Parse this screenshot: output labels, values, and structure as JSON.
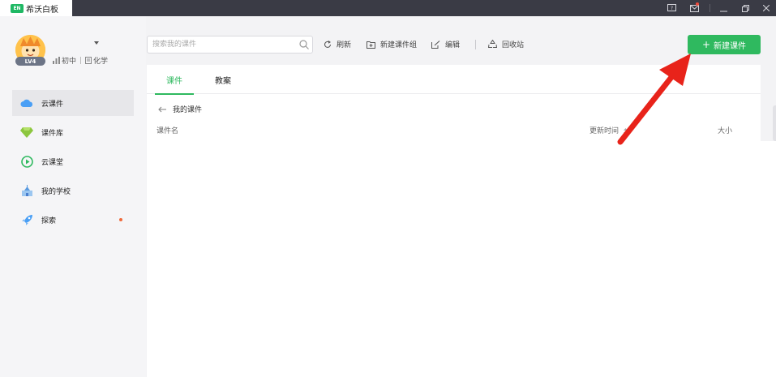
{
  "app": {
    "logo_text": "EN",
    "name": "希沃白板"
  },
  "user": {
    "level": "LV4",
    "grade": "初中",
    "subject": "化学"
  },
  "sidebar": {
    "items": [
      {
        "label": "云课件",
        "icon": "cloud-icon",
        "active": true
      },
      {
        "label": "课件库",
        "icon": "diamond-icon"
      },
      {
        "label": "云课堂",
        "icon": "play-circle-icon"
      },
      {
        "label": "我的学校",
        "icon": "school-icon"
      },
      {
        "label": "探索",
        "icon": "rocket-icon",
        "badge_dot": true
      }
    ]
  },
  "toolbar": {
    "search_placeholder": "搜索我的课件",
    "refresh": "刷新",
    "new_group": "新建课件组",
    "edit": "编辑",
    "recycle": "回收站",
    "new_courseware": "新建课件"
  },
  "tabs": [
    {
      "label": "课件",
      "active": true
    },
    {
      "label": "教案"
    }
  ],
  "breadcrumb": "我的课件",
  "table": {
    "columns": [
      "课件名",
      "更新时间",
      "大小"
    ]
  },
  "colors": {
    "accent": "#2fb95f",
    "titlebar": "#3a3b45",
    "annotation_arrow": "#e8231a"
  }
}
